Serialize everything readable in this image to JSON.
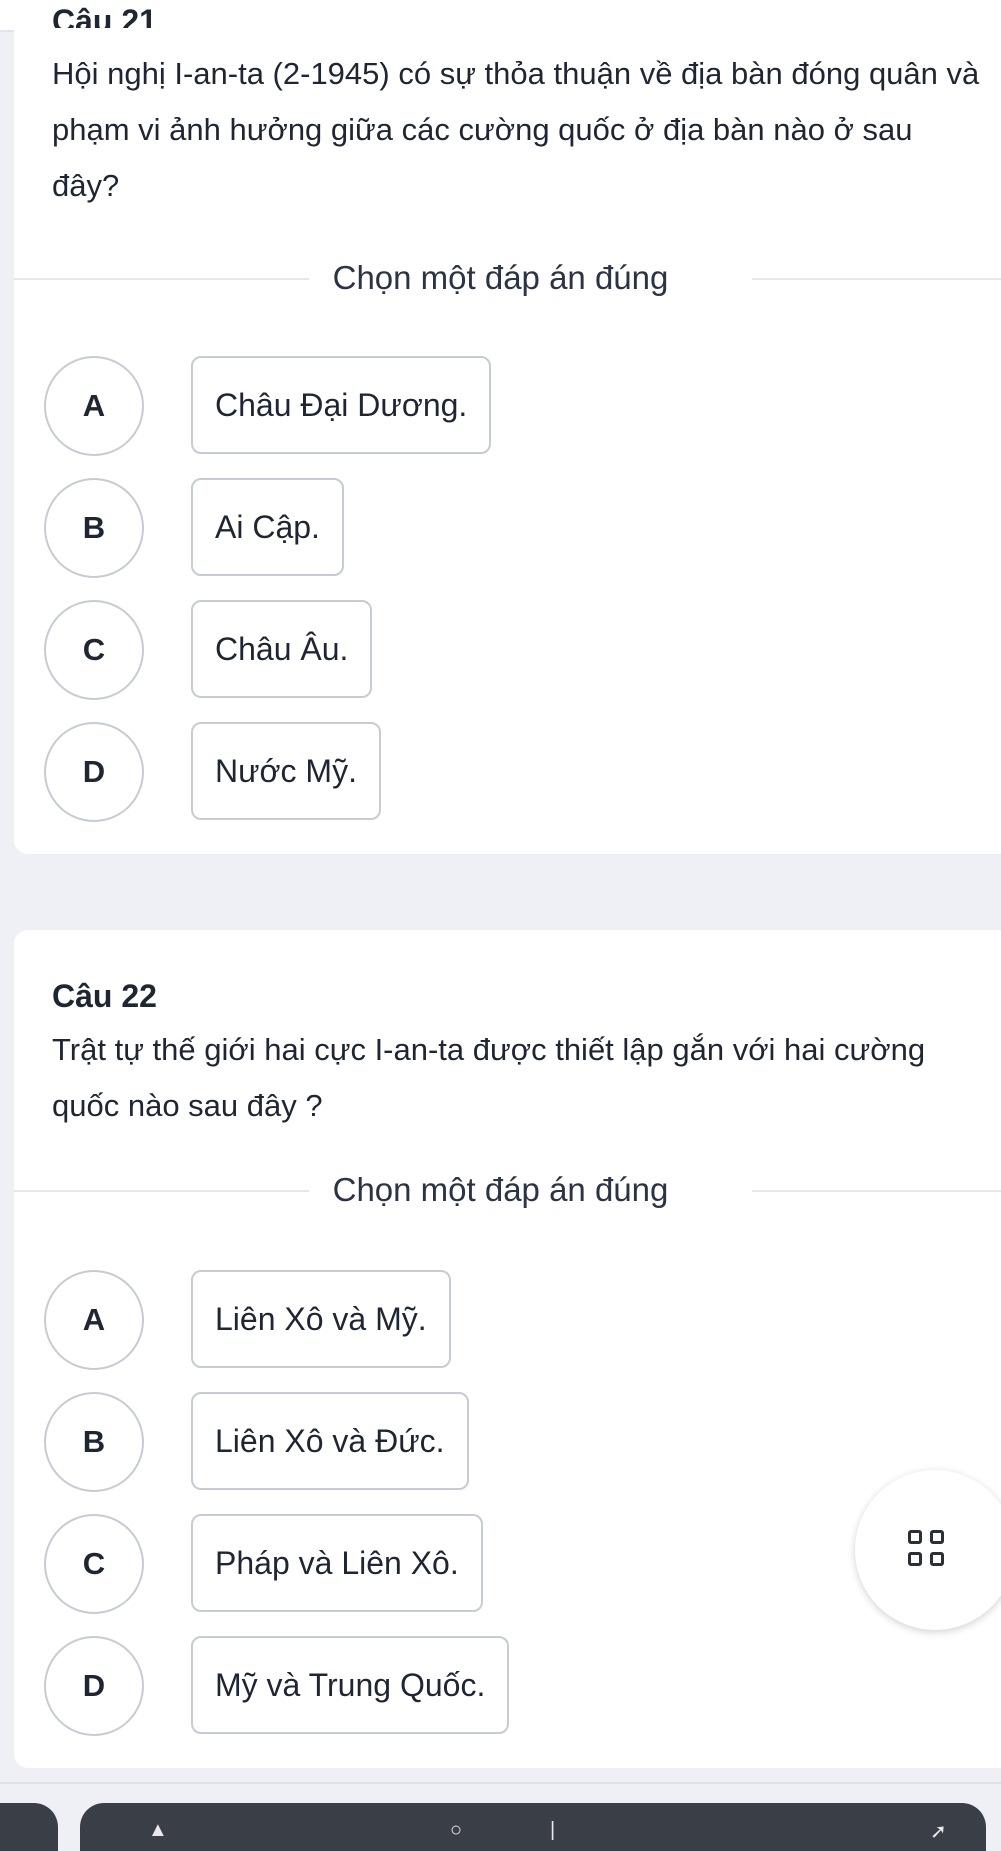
{
  "header": {
    "clipped_title": "Câu 21"
  },
  "questions": [
    {
      "label": "",
      "text": "Hội nghị I-an-ta (2-1945) có sự thỏa thuận về địa bàn đóng quân và phạm vi ảnh hưởng giữa các cường quốc ở địa bàn nào ở sau đây?",
      "prompt": "Chọn một đáp án đúng",
      "options": [
        {
          "letter": "A",
          "text": "Châu Đại Dương."
        },
        {
          "letter": "B",
          "text": "Ai Cập."
        },
        {
          "letter": "C",
          "text": "Châu Âu."
        },
        {
          "letter": "D",
          "text": "Nước Mỹ."
        }
      ]
    },
    {
      "label": "Câu 22",
      "text": "Trật tự thế giới hai cực I-an-ta được thiết lập gắn với hai cường quốc nào sau đây ?",
      "prompt": "Chọn một đáp án đúng",
      "options": [
        {
          "letter": "A",
          "text": "Liên Xô và Mỹ."
        },
        {
          "letter": "B",
          "text": "Liên Xô và Đức."
        },
        {
          "letter": "C",
          "text": "Pháp và Liên Xô."
        },
        {
          "letter": "D",
          "text": "Mỹ và Trung Quốc."
        }
      ]
    }
  ],
  "fab": {
    "icon": "grid-icon"
  },
  "colors": {
    "border": "#c6cbd4",
    "text": "#1f2633",
    "page_bg": "#eef0f5"
  }
}
